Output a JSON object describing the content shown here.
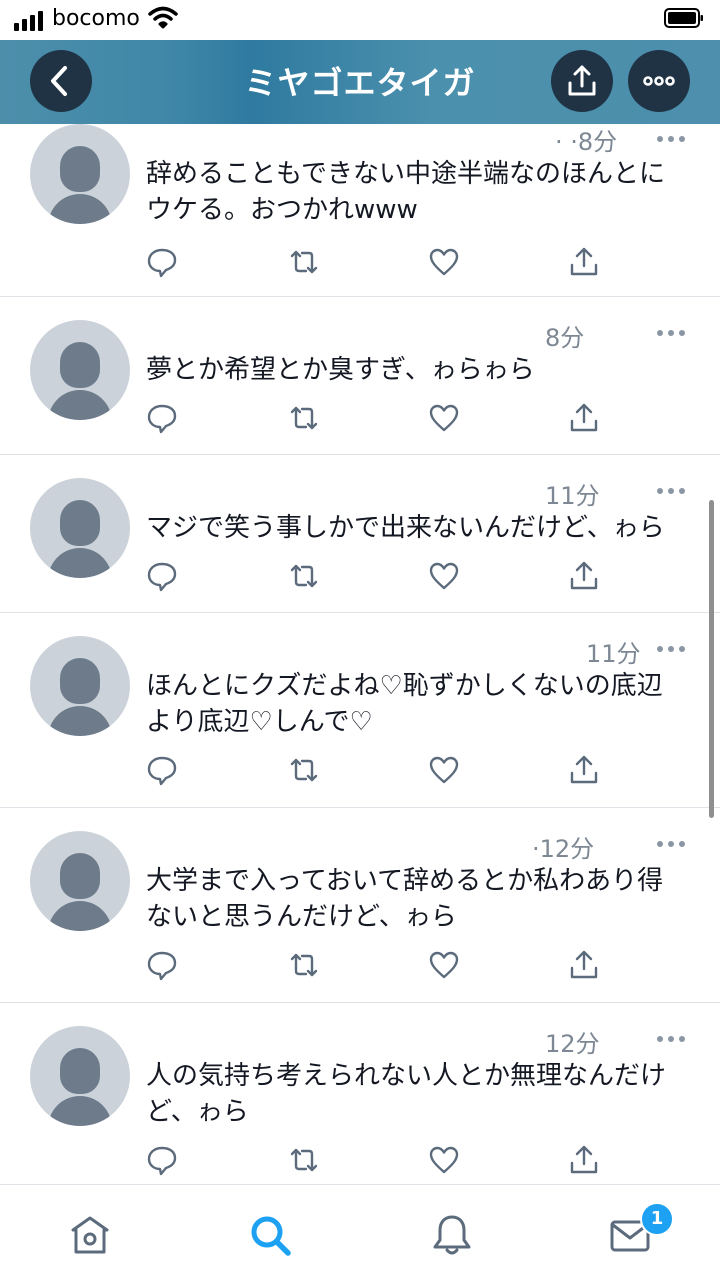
{
  "status_bar": {
    "carrier": "bocomo"
  },
  "header": {
    "title": "ミヤゴエタイガ"
  },
  "tweets": [
    {
      "time": "· ·8分",
      "text": "辞めることもできない中途半端なのほんとに\nウケる。おつかれwww"
    },
    {
      "time": "8分",
      "text": "夢とか希望とか臭すぎ、ゎらゎら"
    },
    {
      "time": "11分",
      "text": "マジで笑う事しかで出来ないんだけど、ゎら"
    },
    {
      "time": "11分",
      "text": "ほんとにクズだよね♡恥ずかしくないの底辺\nより底辺♡しんで♡"
    },
    {
      "time": "·12分",
      "text": "大学まで入っておいて辞めるとか私わあり得\nないと思うんだけど、ゎら"
    },
    {
      "time": "12分",
      "text": "人の気持ち考えられない人とか無理なんだけ\nど、ゎら"
    }
  ],
  "tab_bar": {
    "items": [
      "home-icon",
      "search-icon",
      "notifications-icon",
      "messages-icon"
    ],
    "messages_badge": "1",
    "active_color": "#1da1f2",
    "inactive_color": "#5b6b7c"
  },
  "colors": {
    "header": "#3e86a7",
    "header_button": "#1f3345",
    "action_icon": "#5b6b7c"
  }
}
